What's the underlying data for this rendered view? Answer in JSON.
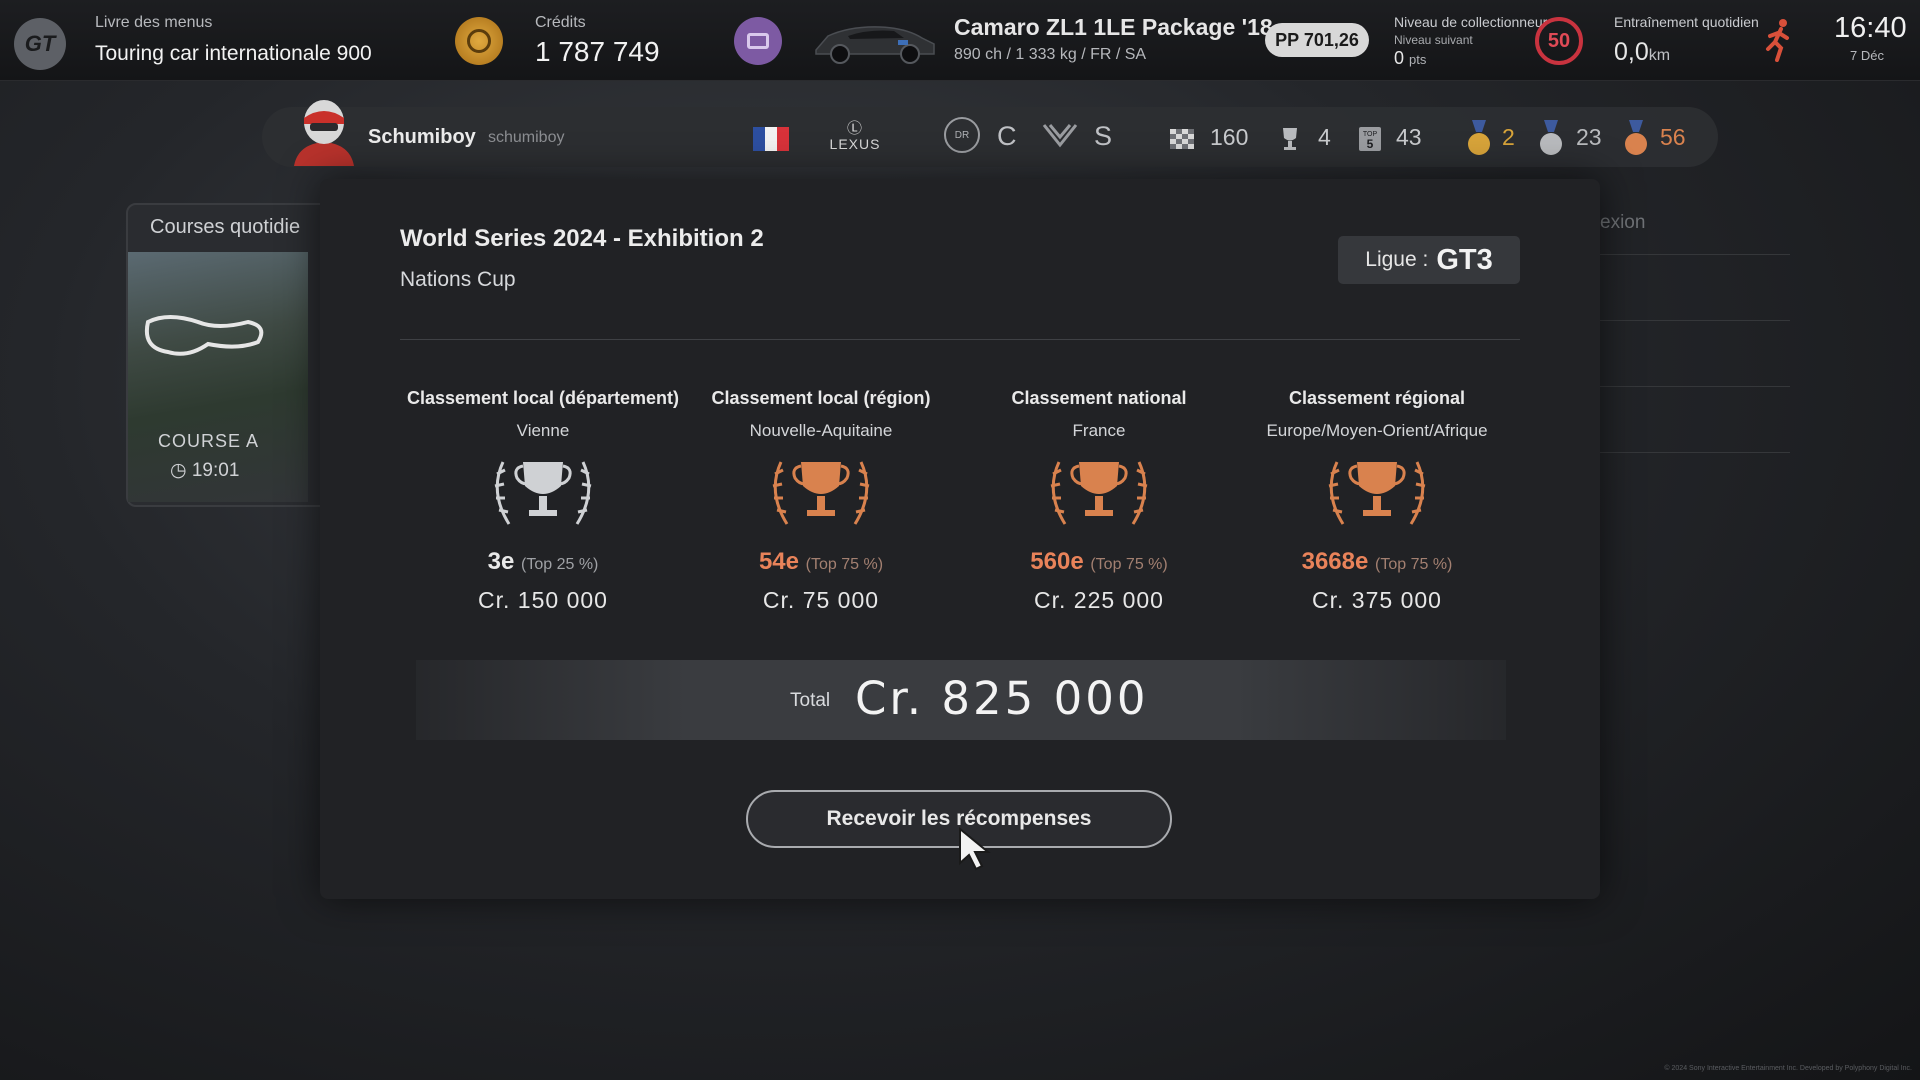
{
  "topbar": {
    "menu_book_label": "Livre des menus",
    "menu_book_value": "Touring car internationale 900",
    "credits_label": "Crédits",
    "credits_value": "1 787 749",
    "car_name": "Camaro ZL1 1LE Package '18",
    "car_specs": "890 ch / 1 333 kg / FR / SA",
    "pp": "PP 701,26",
    "collector_label": "Niveau de collectionneur",
    "collector_next": "Niveau suivant",
    "collector_pts": "0",
    "collector_pts_unit": "pts",
    "collector_level": "50",
    "training_label": "Entraînement quotidien",
    "training_value": "0,0",
    "training_unit": "km",
    "time": "16:40",
    "date": "7 Déc",
    "icons": [
      "gt-logo-icon",
      "credits-coin-icon",
      "garage-icon",
      "car-thumbnail",
      "runner-icon"
    ]
  },
  "profile": {
    "name": "Schumiboy",
    "id": "schumiboy",
    "manufacturer": "LEXUS",
    "dr_letter": "C",
    "sr_letter": "S",
    "dr_badge_text": "DR",
    "stats": [
      {
        "icon": "checkered-flag-icon",
        "value": "160"
      },
      {
        "icon": "trophy-icon",
        "value": "4"
      },
      {
        "icon": "top5-icon",
        "value": "43"
      }
    ],
    "medals": [
      {
        "icon": "gold-medal-icon",
        "value": "2",
        "color": "#d8a43a"
      },
      {
        "icon": "silver-medal-icon",
        "value": "23",
        "color": "#b9bbbe"
      },
      {
        "icon": "bronze-medal-icon",
        "value": "56",
        "color": "#d9824e"
      }
    ]
  },
  "background": {
    "card_title": "Courses quotidie",
    "card_course": "COURSE A",
    "card_time": "19:01",
    "right_label": "exion"
  },
  "modal": {
    "title": "World Series 2024 - Exhibition 2",
    "subtitle": "Nations Cup",
    "league_label": "Ligue :",
    "league_value": "GT3",
    "rankings": [
      {
        "title": "Classement local (département)",
        "area": "Vienne",
        "rank": "3e",
        "pct": "(Top 25 %)",
        "prize": "Cr.   150 000",
        "tier": "silver"
      },
      {
        "title": "Classement local (région)",
        "area": "Nouvelle-Aquitaine",
        "rank": "54e",
        "pct": "(Top 75 %)",
        "prize": "Cr.   75 000",
        "tier": "bronze"
      },
      {
        "title": "Classement national",
        "area": "France",
        "rank": "560e",
        "pct": "(Top 75 %)",
        "prize": "Cr.   225 000",
        "tier": "bronze"
      },
      {
        "title": "Classement régional",
        "area": "Europe/Moyen-Orient/Afrique",
        "rank": "3668e",
        "pct": "(Top 75 %)",
        "prize": "Cr.   375 000",
        "tier": "bronze"
      }
    ],
    "total_label": "Total",
    "total_value": "Cr.   825 000",
    "receive_button": "Recevoir les récompenses"
  },
  "colors": {
    "silver": "#cfd1d4",
    "bronze": "#d9824e",
    "accent_red": "#c9333f"
  },
  "footer": "© 2024 Sony Interactive Entertainment Inc. Developed by Polyphony Digital Inc."
}
